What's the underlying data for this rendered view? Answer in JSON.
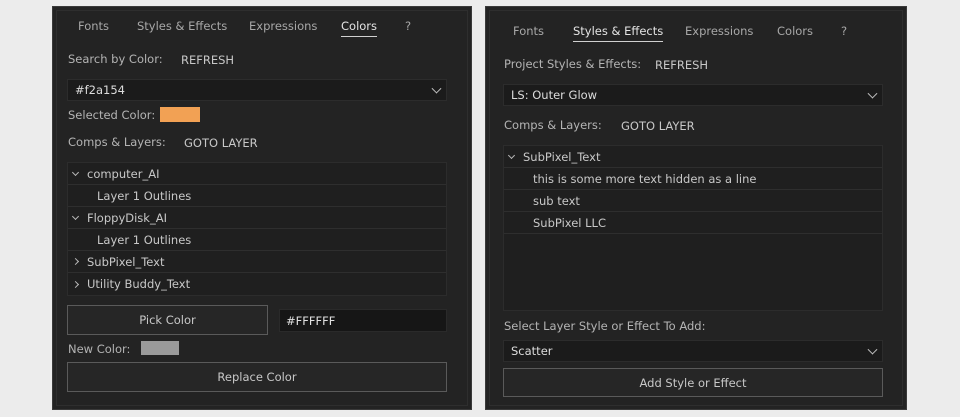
{
  "colors_panel": {
    "tabs": [
      "Fonts",
      "Styles & Effects",
      "Expressions",
      "Colors",
      "?"
    ],
    "active_tab": "Colors",
    "search_label": "Search by Color:",
    "refresh_label": "REFRESH",
    "color_select_value": "#f2a154",
    "selected_color_label": "Selected Color:",
    "selected_color": "#f2a154",
    "comps_layers_label": "Comps & Layers:",
    "goto_layer_label": "GOTO LAYER",
    "tree": [
      {
        "label": "computer_AI",
        "expanded": true,
        "depth": 0
      },
      {
        "label": "Layer 1 Outlines",
        "depth": 1
      },
      {
        "label": "FloppyDisk_AI",
        "expanded": true,
        "depth": 0
      },
      {
        "label": "Layer 1 Outlines",
        "depth": 1
      },
      {
        "label": "SubPixel_Text",
        "expanded": false,
        "depth": 0
      },
      {
        "label": "Utility Buddy_Text",
        "expanded": false,
        "depth": 0
      }
    ],
    "pick_color_label": "Pick Color",
    "hex_value": "#FFFFFF",
    "new_color_label": "New Color:",
    "new_color": "#9a9a9a",
    "replace_color_label": "Replace Color"
  },
  "styles_panel": {
    "tabs": [
      "Fonts",
      "Styles & Effects",
      "Expressions",
      "Colors",
      "?"
    ],
    "active_tab": "Styles & Effects",
    "project_label": "Project Styles & Effects:",
    "refresh_label": "REFRESH",
    "style_select_value": "LS: Outer Glow",
    "comps_layers_label": "Comps & Layers:",
    "goto_layer_label": "GOTO LAYER",
    "tree": [
      {
        "label": "SubPixel_Text",
        "expanded": true,
        "depth": 0
      },
      {
        "label": "this is some more text hidden as a line",
        "depth": 1
      },
      {
        "label": "sub text",
        "depth": 1
      },
      {
        "label": "SubPixel LLC",
        "depth": 1
      }
    ],
    "select_style_label": "Select Layer Style or Effect To Add:",
    "effect_select_value": "Scatter",
    "add_button_label": "Add Style or Effect"
  }
}
